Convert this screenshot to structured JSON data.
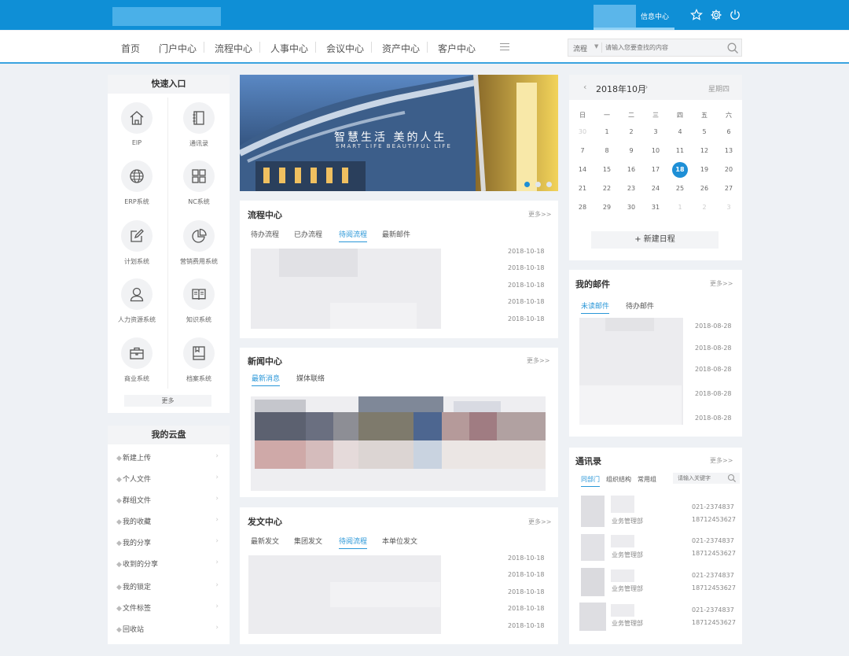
{
  "header": {
    "message_center": "信息中心"
  },
  "nav": {
    "items": [
      "首页",
      "门户中心",
      "流程中心",
      "人事中心",
      "会议中心",
      "资产中心",
      "客户中心"
    ],
    "search_type": "流程",
    "search_placeholder": "请输入您要查找的内容"
  },
  "quick": {
    "title": "快速入口",
    "items": [
      {
        "label": "EIP",
        "icon": "home-icon"
      },
      {
        "label": "通讯录",
        "icon": "address-book-icon"
      },
      {
        "label": "ERP系统",
        "icon": "globe-icon"
      },
      {
        "label": "NC系统",
        "icon": "grid-icon"
      },
      {
        "label": "计划系统",
        "icon": "edit-icon"
      },
      {
        "label": "营销费用系统",
        "icon": "pie-chart-icon"
      },
      {
        "label": "人力资源系统",
        "icon": "user-icon"
      },
      {
        "label": "知识系统",
        "icon": "book-icon"
      },
      {
        "label": "商业系统",
        "icon": "briefcase-icon"
      },
      {
        "label": "档案系统",
        "icon": "archive-icon"
      }
    ],
    "more": "更多"
  },
  "cloud": {
    "title": "我的云盘",
    "items": [
      "新建上传",
      "个人文件",
      "群组文件",
      "我的收藏",
      "我的分享",
      "收到的分享",
      "我的锁定",
      "文件标签",
      "回收站"
    ]
  },
  "banner": {
    "title": "智慧生活   美的人生",
    "subtitle": "SMART LIFE BEAUTIFUL LIFE"
  },
  "process": {
    "title": "流程中心",
    "more": "更多>>",
    "tabs": [
      "待办流程",
      "已办流程",
      "待阅流程",
      "最新邮件"
    ],
    "active_tab": 2,
    "dates": [
      "2018-10-18",
      "2018-10-18",
      "2018-10-18",
      "2018-10-18",
      "2018-10-18"
    ]
  },
  "news": {
    "title": "新闻中心",
    "more": "更多>>",
    "tabs": [
      "最新消息",
      "媒体联络"
    ],
    "active_tab": 0
  },
  "docs": {
    "title": "发文中心",
    "more": "更多>>",
    "tabs": [
      "最新发文",
      "集团发文",
      "待阅流程",
      "本单位发文"
    ],
    "active_tab": 2,
    "dates": [
      "2018-10-18",
      "2018-10-18",
      "2018-10-18",
      "2018-10-18",
      "2018-10-18"
    ]
  },
  "calendar": {
    "month": "2018年10月",
    "weekday": "星期四",
    "weekdays": [
      "日",
      "一",
      "二",
      "三",
      "四",
      "五",
      "六"
    ],
    "days": [
      [
        "30",
        "1",
        "2",
        "3",
        "4",
        "5",
        "6"
      ],
      [
        "7",
        "8",
        "9",
        "10",
        "11",
        "12",
        "13"
      ],
      [
        "14",
        "15",
        "16",
        "17",
        "18",
        "19",
        "20"
      ],
      [
        "21",
        "22",
        "23",
        "24",
        "25",
        "26",
        "27"
      ],
      [
        "28",
        "29",
        "30",
        "31",
        "1",
        "2",
        "3"
      ]
    ],
    "today": "18",
    "new_schedule": "新建日程"
  },
  "mail": {
    "title": "我的邮件",
    "more": "更多>>",
    "tabs": [
      "未读邮件",
      "待办邮件"
    ],
    "active_tab": 0,
    "dates": [
      "2018-08-28",
      "2018-08-28",
      "2018-08-28",
      "2018-08-28",
      "2018-08-28"
    ]
  },
  "addressbook": {
    "title": "通讯录",
    "more": "更多>>",
    "tabs": [
      "同部门",
      "组织结构",
      "常用组"
    ],
    "active_tab": 0,
    "search_placeholder": "请输入关键字",
    "contacts": [
      {
        "dept": "业务管理部",
        "phone": "021-2374837",
        "mobile": "18712453627"
      },
      {
        "dept": "业务管理部",
        "phone": "021-2374837",
        "mobile": "18712453627"
      },
      {
        "dept": "业务管理部",
        "phone": "021-2374837",
        "mobile": "18712453627"
      },
      {
        "dept": "业务管理部",
        "phone": "021-2374837",
        "mobile": "18712453627"
      }
    ]
  },
  "colors": {
    "primary": "#0f8fd6",
    "accent": "#2a97d8",
    "background": "#eef1f5"
  }
}
